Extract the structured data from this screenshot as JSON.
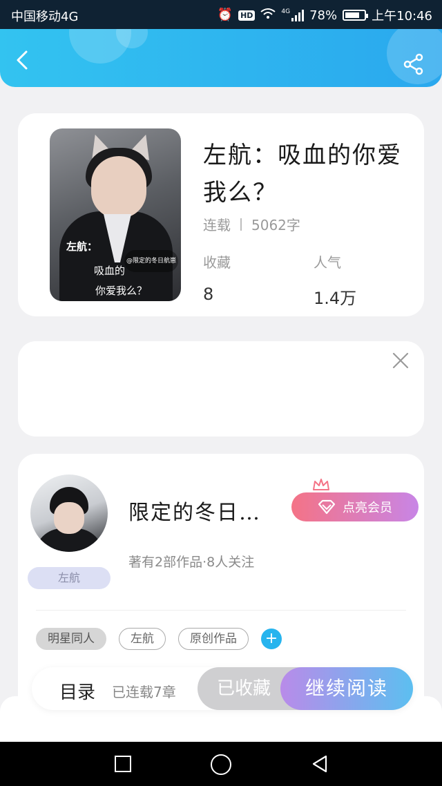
{
  "status_bar": {
    "carrier": "中国移动4G",
    "hd": "HD",
    "network": "4G",
    "battery": "78%",
    "battery_level": 0.78,
    "time": "上午10:46"
  },
  "header": {
    "back_icon": "chevron-left-icon",
    "share_icon": "share-icon",
    "accent_color": "#2aa8ee"
  },
  "book": {
    "title": "左航：吸血的你爱我么？",
    "status": "连载",
    "word_count": "5062字",
    "favorites_label": "收藏",
    "favorites_value": "8",
    "popularity_label": "人气",
    "popularity_value": "1.4万",
    "cover_text_1": "左航：",
    "cover_text_2": "吸血的",
    "cover_text_3": "你爱我么？",
    "cover_tag": "@限定的冬日航崽"
  },
  "ad": {
    "close_icon": "close-icon"
  },
  "author": {
    "name": "限定的冬日…",
    "badge": "左航",
    "stats": "著有2部作品·8人关注",
    "vip_button": "点亮会员",
    "tags": [
      "明星同人",
      "左航",
      "原创作品"
    ],
    "add_tag_icon": "plus-icon"
  },
  "action_bar": {
    "toc": "目录",
    "chapters": "已连载7章",
    "collected": "已收藏",
    "read": "继续阅读"
  },
  "nav": {
    "recent_icon": "square-icon",
    "home_icon": "circle-icon",
    "back_icon": "triangle-back-icon"
  }
}
